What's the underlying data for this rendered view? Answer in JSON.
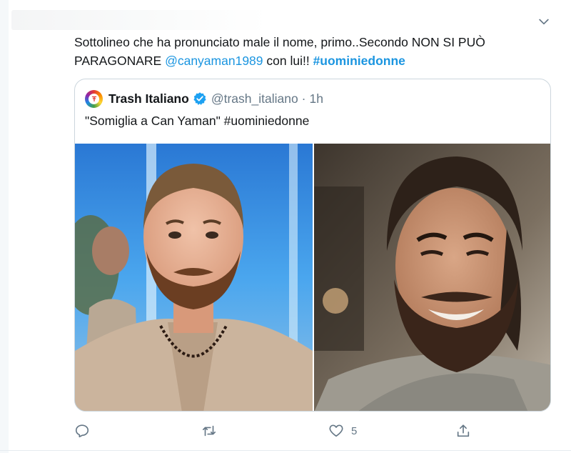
{
  "colors": {
    "link": "#1b95e0",
    "text": "#14171a",
    "muted": "#657786",
    "border": "#ccd6dd",
    "verified": "#1da1f2"
  },
  "tweet": {
    "text_parts": [
      "Sottolineo che ha pronunciato male il nome, primo..Secondo NON SI PUÒ PARAGONARE ",
      "@canyaman1989",
      " con lui!! ",
      "#uominiedonne"
    ],
    "menu_icon": "chevron-down-icon"
  },
  "quoted_tweet": {
    "name": "Trash Italiano",
    "handle": "@trash_italiano",
    "separator": "·",
    "time": "1h",
    "text": "\"Somiglia a Can Yaman\" #uominiedonne",
    "verified_icon": "verified-badge-icon"
  },
  "actions": {
    "reply_count": "",
    "retweet_count": "",
    "like_count": "5",
    "share_count": ""
  }
}
